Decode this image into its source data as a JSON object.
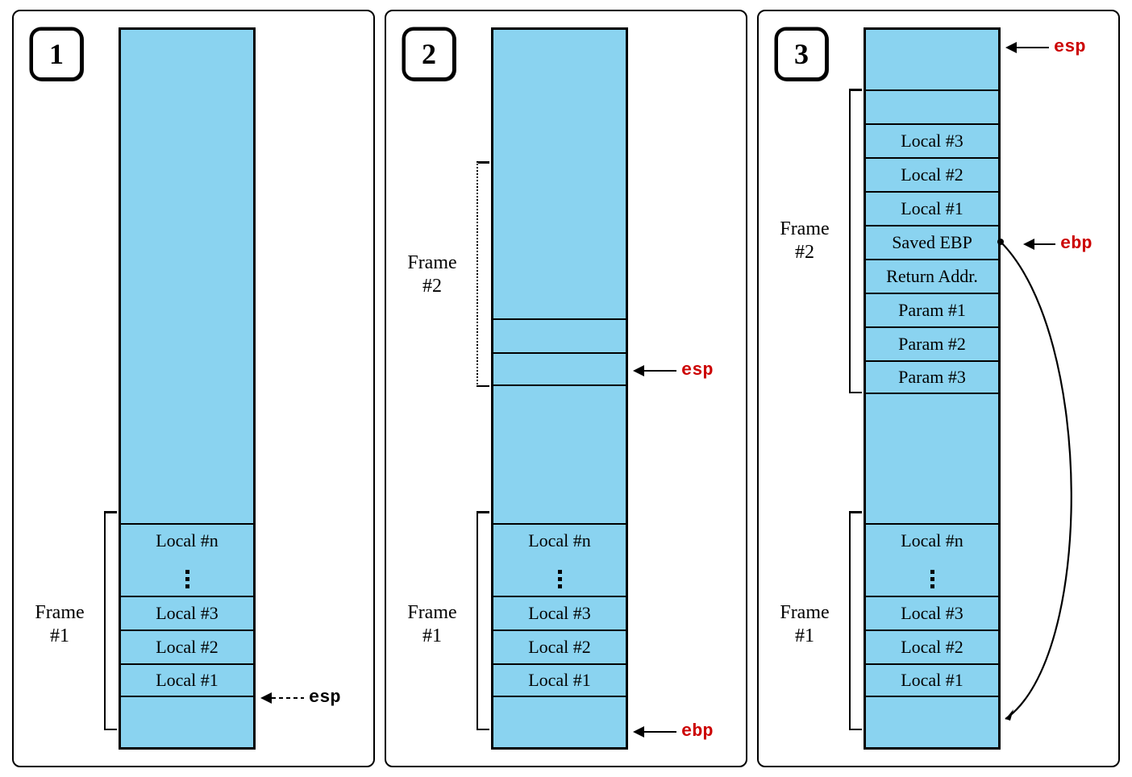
{
  "panels": [
    {
      "number": "1",
      "frame1_label_line1": "Frame",
      "frame1_label_line2": "#1",
      "cells": {
        "local_n": "Local #n",
        "local_3": "Local #3",
        "local_2": "Local #2",
        "local_1": "Local #1"
      },
      "pointers": {
        "esp": "esp"
      }
    },
    {
      "number": "2",
      "frame1_label_line1": "Frame",
      "frame1_label_line2": "#1",
      "frame2_label_line1": "Frame",
      "frame2_label_line2": "#2",
      "cells": {
        "local_n": "Local #n",
        "local_3": "Local #3",
        "local_2": "Local #2",
        "local_1": "Local #1"
      },
      "pointers": {
        "esp": "esp",
        "ebp": "ebp"
      }
    },
    {
      "number": "3",
      "frame1_label_line1": "Frame",
      "frame1_label_line2": "#1",
      "frame2_label_line1": "Frame",
      "frame2_label_line2": "#2",
      "cells_f1": {
        "local_n": "Local #n",
        "local_3": "Local #3",
        "local_2": "Local #2",
        "local_1": "Local #1"
      },
      "cells_f2": {
        "local_3": "Local #3",
        "local_2": "Local #2",
        "local_1": "Local #1",
        "saved_ebp": "Saved EBP",
        "return_addr": "Return Addr.",
        "param_1": "Param #1",
        "param_2": "Param #2",
        "param_3": "Param #3"
      },
      "pointers": {
        "esp": "esp",
        "ebp": "ebp"
      }
    }
  ]
}
